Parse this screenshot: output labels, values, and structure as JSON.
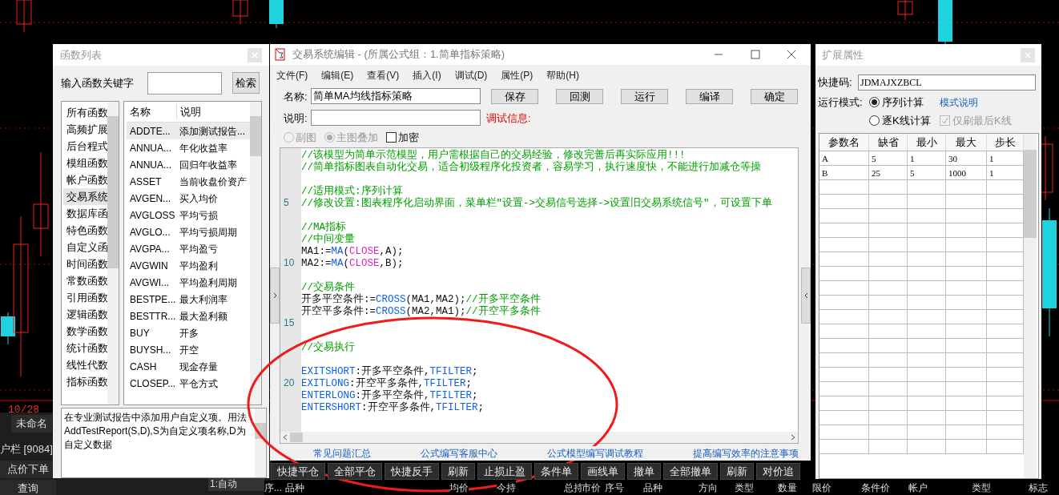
{
  "chart": {
    "date_label": "10/28"
  },
  "taskbar": {
    "tab": "未命名",
    "account": "户栏 [9084]",
    "buttons": [
      "点价下单",
      "查询"
    ],
    "mode_field": "1:自动"
  },
  "function_list": {
    "title": "函数列表",
    "search_label": "输入函数关键字",
    "search_button": "检索",
    "categories": [
      {
        "label": "所有函数",
        "selected": false
      },
      {
        "label": "高频扩展",
        "selected": false
      },
      {
        "label": "后台程式",
        "selected": false
      },
      {
        "label": "模组函数",
        "selected": false
      },
      {
        "label": "帐户函数",
        "selected": false
      },
      {
        "label": "交易系统",
        "selected": true
      },
      {
        "label": "数据库函",
        "selected": false
      },
      {
        "label": "特色函数",
        "selected": false
      },
      {
        "label": "自定义函",
        "selected": false
      },
      {
        "label": "时间函数",
        "selected": false
      },
      {
        "label": "常数函数",
        "selected": false
      },
      {
        "label": "引用函数",
        "selected": false
      },
      {
        "label": "逻辑函数",
        "selected": false
      },
      {
        "label": "数学函数",
        "selected": false
      },
      {
        "label": "统计函数",
        "selected": false
      },
      {
        "label": "线性代数",
        "selected": false
      },
      {
        "label": "指标函数",
        "selected": false
      }
    ],
    "columns": [
      "名称",
      "说明"
    ],
    "functions": [
      {
        "name": "ADDTE...",
        "description": "添加测试报告...",
        "selected": true
      },
      {
        "name": "ANNUA...",
        "description": "年化收益率",
        "selected": false
      },
      {
        "name": "ANNUA...",
        "description": "回归年收益率",
        "selected": false
      },
      {
        "name": "ASSET",
        "description": "当前收盘价资产",
        "selected": false
      },
      {
        "name": "AVGEN...",
        "description": "买入均价",
        "selected": false
      },
      {
        "name": "AVGLOSS",
        "description": "平均亏损",
        "selected": false
      },
      {
        "name": "AVGLO...",
        "description": "平均亏损周期",
        "selected": false
      },
      {
        "name": "AVGPA...",
        "description": "平均盈亏",
        "selected": false
      },
      {
        "name": "AVGWIN",
        "description": "平均盈利",
        "selected": false
      },
      {
        "name": "AVGWI...",
        "description": "平均盈利周期",
        "selected": false
      },
      {
        "name": "BESTPE...",
        "description": "最大利润率",
        "selected": false
      },
      {
        "name": "BESTTR...",
        "description": "最大盈利额",
        "selected": false
      },
      {
        "name": "BUY",
        "description": "开多",
        "selected": false
      },
      {
        "name": "BUYSH...",
        "description": "开空",
        "selected": false
      },
      {
        "name": "CASH",
        "description": "现金存量",
        "selected": false
      },
      {
        "name": "CLOSEP...",
        "description": "平仓方式",
        "selected": false
      }
    ],
    "description": "在专业测试报告中添加用户自定义项。用法AddTestReport(S,D),S为自定义项名称,D为自定义数据"
  },
  "editor": {
    "title": "交易系统编辑 - (所属公式组：1.简单指标策略)",
    "menu": [
      "文件(F)",
      "编辑(E)",
      "查看(V)",
      "插入(I)",
      "调试(D)",
      "属性(P)",
      "帮助(H)"
    ],
    "name_label": "名称:",
    "name_value": "简单MA均线指标策略",
    "buttons": [
      "保存",
      "回测",
      "运行",
      "编译",
      "确定"
    ],
    "desc_label": "说明:",
    "debug_label": "调试信息:",
    "options": [
      {
        "kind": "radio",
        "label": "副图",
        "checked": false,
        "disabled": true
      },
      {
        "kind": "radio",
        "label": "主图叠加",
        "checked": true,
        "disabled": true
      },
      {
        "kind": "checkbox",
        "label": "加密",
        "checked": false,
        "disabled": false
      }
    ],
    "code": [
      {
        "kind": "code",
        "segments": [
          {
            "kind": "comment",
            "text": "//该模型为简单示范模型，用户需根据自己的交易经验，修改完善后再实际应用!!!"
          }
        ]
      },
      {
        "kind": "code",
        "segments": [
          {
            "kind": "comment",
            "text": "//简单指标图表自动化交易，适合初级程序化投资者，容易学习，执行速度快，不能进行加减仓等操"
          }
        ]
      },
      {
        "kind": "blank"
      },
      {
        "kind": "code",
        "segments": [
          {
            "kind": "comment",
            "text": "//适用模式:序列计算"
          }
        ]
      },
      {
        "kind": "code",
        "line_number": "5",
        "segments": [
          {
            "kind": "comment",
            "text": "//修改设置:图表程序化启动界面，菜单栏\"设置->交易信号选择->设置旧交易系统信号\"，可设置下单"
          }
        ]
      },
      {
        "kind": "blank"
      },
      {
        "kind": "code",
        "segments": [
          {
            "kind": "comment",
            "text": "//MA指标"
          }
        ]
      },
      {
        "kind": "code",
        "segments": [
          {
            "kind": "comment",
            "text": "//中间变量"
          }
        ]
      },
      {
        "kind": "code",
        "segments": [
          {
            "kind": "plain",
            "text": "MA1:="
          },
          {
            "kind": "function",
            "text": "MA"
          },
          {
            "kind": "plain",
            "text": "("
          },
          {
            "kind": "series",
            "text": "CLOSE"
          },
          {
            "kind": "plain",
            "text": ",A);"
          }
        ]
      },
      {
        "kind": "code",
        "line_number": "10",
        "segments": [
          {
            "kind": "plain",
            "text": "MA2:="
          },
          {
            "kind": "function",
            "text": "MA"
          },
          {
            "kind": "plain",
            "text": "("
          },
          {
            "kind": "series",
            "text": "CLOSE"
          },
          {
            "kind": "plain",
            "text": ",B);"
          }
        ]
      },
      {
        "kind": "blank"
      },
      {
        "kind": "code",
        "segments": [
          {
            "kind": "comment",
            "text": "//交易条件"
          }
        ]
      },
      {
        "kind": "code",
        "segments": [
          {
            "kind": "plain",
            "text": "开多平空条件:="
          },
          {
            "kind": "function",
            "text": "CROSS"
          },
          {
            "kind": "plain",
            "text": "(MA1,MA2);"
          },
          {
            "kind": "comment",
            "text": "//开多平空条件"
          }
        ]
      },
      {
        "kind": "code",
        "segments": [
          {
            "kind": "plain",
            "text": "开空平多条件:="
          },
          {
            "kind": "function",
            "text": "CROSS"
          },
          {
            "kind": "plain",
            "text": "(MA2,MA1);"
          },
          {
            "kind": "comment",
            "text": "//开空平多条件"
          }
        ]
      },
      {
        "kind": "blank",
        "line_number": "15"
      },
      {
        "kind": "blank"
      },
      {
        "kind": "code",
        "segments": [
          {
            "kind": "comment",
            "text": "//交易执行"
          }
        ]
      },
      {
        "kind": "blank"
      },
      {
        "kind": "code",
        "segments": [
          {
            "kind": "function",
            "text": "EXITSHORT"
          },
          {
            "kind": "plain",
            "text": ":开多平空条件,"
          },
          {
            "kind": "function",
            "text": "TFILTER"
          },
          {
            "kind": "plain",
            "text": ";"
          }
        ]
      },
      {
        "kind": "code",
        "line_number": "20",
        "segments": [
          {
            "kind": "function",
            "text": "EXITLONG"
          },
          {
            "kind": "plain",
            "text": ":开空平多条件,"
          },
          {
            "kind": "function",
            "text": "TFILTER"
          },
          {
            "kind": "plain",
            "text": ";"
          }
        ]
      },
      {
        "kind": "code",
        "segments": [
          {
            "kind": "function",
            "text": "ENTERLONG"
          },
          {
            "kind": "plain",
            "text": ":开多平空条件,"
          },
          {
            "kind": "function",
            "text": "TFILTER"
          },
          {
            "kind": "plain",
            "text": ";"
          }
        ]
      },
      {
        "kind": "code",
        "segments": [
          {
            "kind": "function",
            "text": "ENTERSHORT"
          },
          {
            "kind": "plain",
            "text": ":开空平多条件,"
          },
          {
            "kind": "function",
            "text": "TFILTER"
          },
          {
            "kind": "plain",
            "text": ";"
          }
        ]
      }
    ],
    "links": [
      "常见问题汇总",
      "公式编写客服中心",
      "公式模型编写调试教程",
      "提高编写效率的注意事项"
    ]
  },
  "properties": {
    "title": "扩展属性",
    "shortcut_label": "快捷码:",
    "shortcut_value": "JDMAJXZBCL",
    "mode_label": "运行模式:",
    "modes": [
      {
        "label": "序列计算",
        "selected": true
      },
      {
        "label": "逐K线计算",
        "selected": false
      }
    ],
    "mode_help_link": "模式说明",
    "last_bar_option": {
      "label": "仅刷最后K线",
      "checked": true,
      "disabled": true
    },
    "columns": [
      "参数名",
      "缺省",
      "最小",
      "最大",
      "步长"
    ],
    "rows": [
      [
        "A",
        "5",
        "1",
        "30",
        "1"
      ],
      [
        "B",
        "25",
        "5",
        "1000",
        "1"
      ]
    ]
  },
  "toolbar": [
    "快捷平仓",
    "全部平仓",
    "快捷反手",
    "刷新",
    "止损止盈",
    "条件单",
    "画线单",
    "撤单",
    "全部撤单",
    "刷新",
    "对价追"
  ],
  "positions_columns": [
    "序...",
    "品种",
    "均价",
    "今持",
    "总持",
    "市价",
    "序号",
    "品种",
    "方向",
    "类型",
    "数量",
    "限价",
    "条件价",
    "帐户",
    "类型",
    "标志"
  ]
}
